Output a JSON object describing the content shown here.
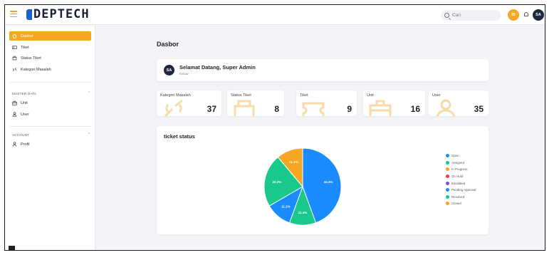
{
  "app": {
    "logo_text": "DEPTECH"
  },
  "topbar": {
    "search_placeholder": "Cari",
    "user_initials_1": "ID",
    "user_initials_2": "SA"
  },
  "sidebar": {
    "items": [
      {
        "label": "Dasbor",
        "icon": "home-icon",
        "active": true
      },
      {
        "label": "Tiket",
        "icon": "ticket-icon"
      },
      {
        "label": "Status Tiket",
        "icon": "status-icon"
      },
      {
        "label": "Kategori Masalah",
        "icon": "link-icon"
      }
    ],
    "master_title": "MASTER DATA",
    "master_items": [
      {
        "label": "Unit",
        "icon": "unit-icon"
      },
      {
        "label": "User",
        "icon": "users-icon"
      }
    ],
    "account_title": "ACCOUNT",
    "account_items": [
      {
        "label": "Profil",
        "icon": "user-icon"
      }
    ]
  },
  "main": {
    "title": "Dasbor",
    "welcome": {
      "initials": "SA",
      "title": "Selamat Datang, Super Admin",
      "subtitle": "Keluar"
    },
    "stats": [
      {
        "label": "Kategori Masalah",
        "value": "37"
      },
      {
        "label": "Status Tiket",
        "value": "8"
      },
      {
        "label": "Tiket",
        "value": "9"
      },
      {
        "label": "Unit",
        "value": "16"
      },
      {
        "label": "User",
        "value": "35"
      }
    ],
    "chart_title": "ticket status"
  },
  "colors": {
    "accent": "#f5a623",
    "blue": "#1a8cff",
    "green": "#19c98c"
  },
  "chart_data": {
    "type": "pie",
    "title": "ticket status",
    "legend_position": "right",
    "categories": [
      "Open",
      "Assigned",
      "In Progress",
      "On Hold",
      "Escalated",
      "Pending Approval",
      "Resolved",
      "Closed"
    ],
    "legend_colors": [
      "#1a8cff",
      "#19c98c",
      "#f5a623",
      "#f0384e",
      "#7b4fd6",
      "#1a8cff",
      "#19c98c",
      "#f5a623"
    ],
    "slices": [
      {
        "value": 44.4,
        "label": "44.4%",
        "color": "#1a8cff"
      },
      {
        "value": 11.1,
        "label": "11.1%",
        "color": "#19c98c"
      },
      {
        "value": 11.1,
        "label": "11.1%",
        "color": "#1a8cff"
      },
      {
        "value": 22.2,
        "label": "22.2%",
        "color": "#19c98c"
      },
      {
        "value": 11.1,
        "label": "11.1%",
        "color": "#f5a623"
      }
    ]
  }
}
